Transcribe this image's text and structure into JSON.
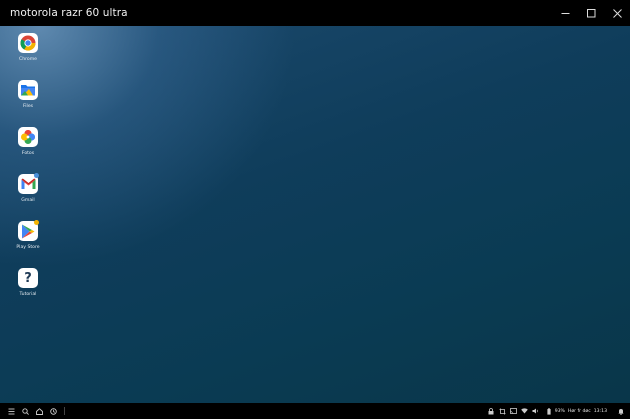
{
  "window": {
    "title": "motorola razr 60 ultra"
  },
  "apps": [
    {
      "label": "Chrome",
      "icon": "chrome-icon"
    },
    {
      "label": "Files",
      "icon": "files-icon"
    },
    {
      "label": "Fotos",
      "icon": "photos-icon"
    },
    {
      "label": "Gmail",
      "icon": "gmail-icon"
    },
    {
      "label": "Play Store",
      "icon": "play-store-icon"
    },
    {
      "label": "Tutorial",
      "icon": "help-icon"
    }
  ],
  "taskbar": {
    "battery": "93%",
    "date": "Hør fr døc",
    "time": "13:13"
  },
  "colors": {
    "accent": "#4a90d9",
    "badge": "#f5b400",
    "desktop_top": "#1c4a6e",
    "desktop_bottom": "#093649"
  }
}
